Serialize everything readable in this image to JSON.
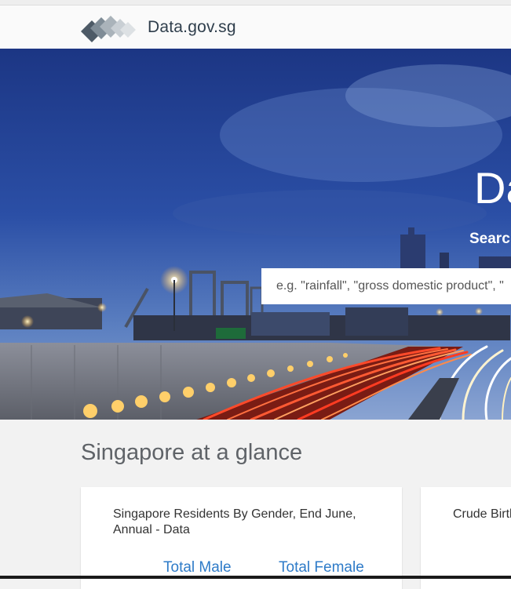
{
  "header": {
    "brand": "Data.gov.sg",
    "logo_icon": "diamond-logo-icon"
  },
  "hero": {
    "title": "Da",
    "subtitle": "Searc",
    "search": {
      "placeholder": "e.g. \"rainfall\", \"gross domestic product\", \""
    }
  },
  "section": {
    "title": "Singapore at a glance"
  },
  "cards": [
    {
      "title": "Singapore Residents By Gender, End June, Annual - Data",
      "legend": [
        "Total Male",
        "Total Female"
      ]
    },
    {
      "title": "Crude Birtl"
    }
  ],
  "colors": {
    "sky_top": "#1f3d8a",
    "sky_bottom": "#6f8fc7",
    "link": "#2e7bc8",
    "brand_text": "#2f3e4c"
  }
}
